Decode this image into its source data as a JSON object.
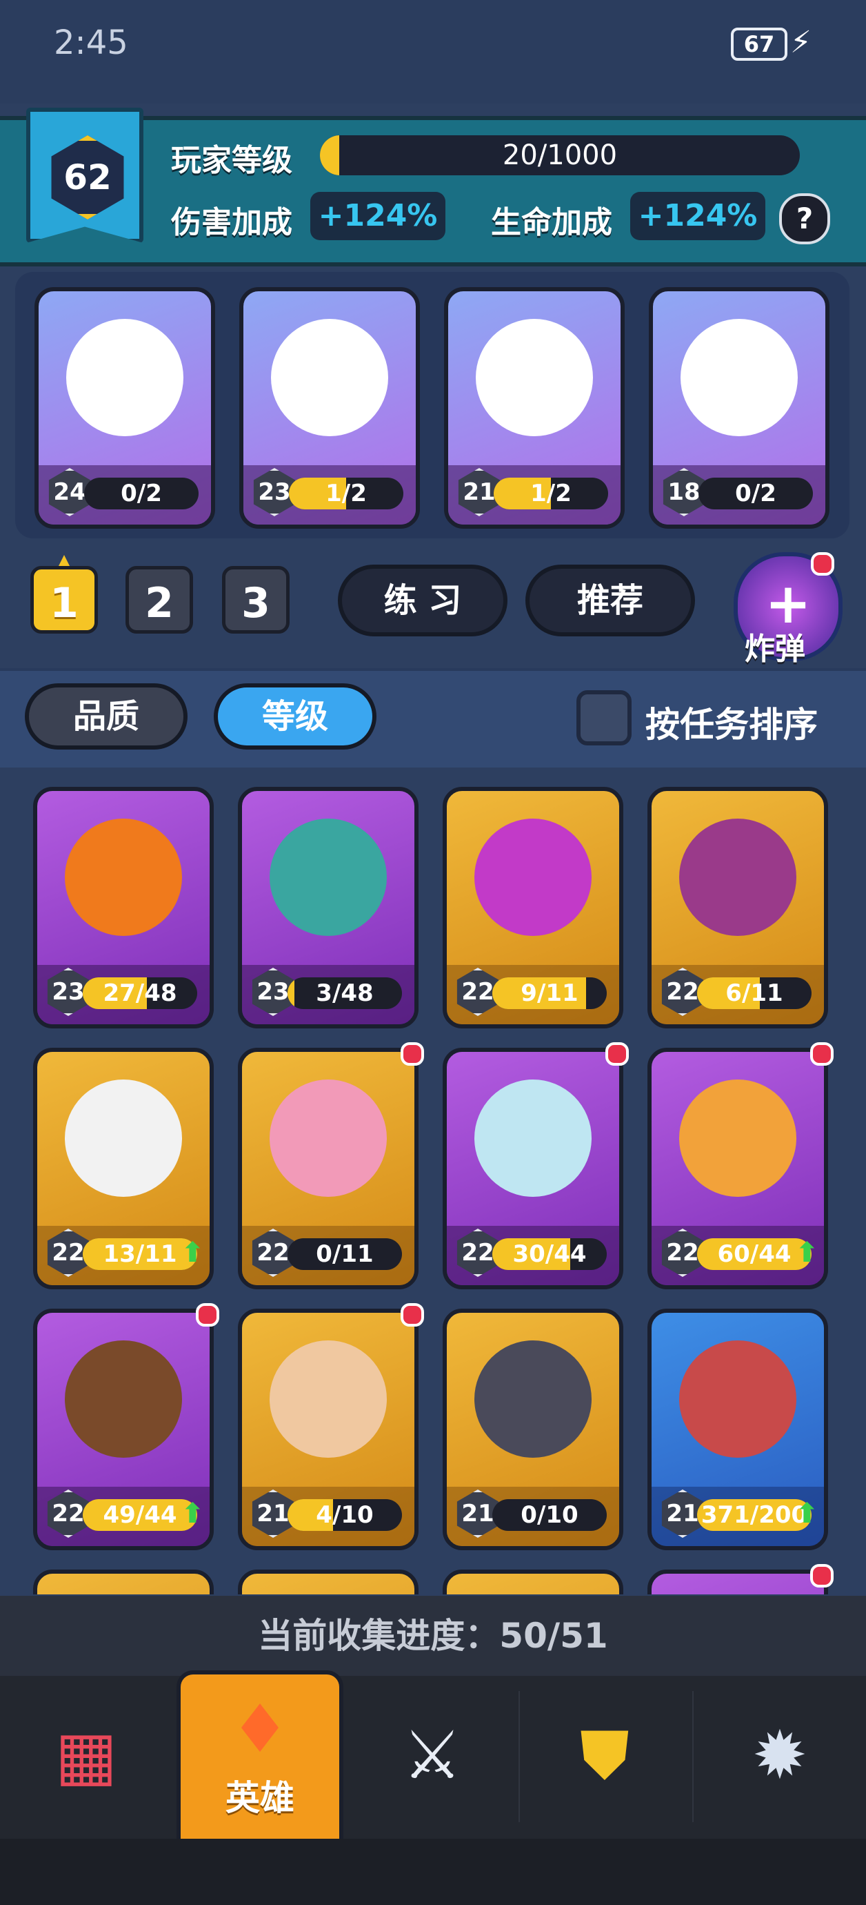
{
  "status_bar": {
    "time": "2:45",
    "battery": "67"
  },
  "player": {
    "level": "62",
    "xp_label": "玩家等级",
    "xp_text": "20/1000",
    "xp_progress": 0.02,
    "damage_label": "伤害加成",
    "damage_value": "+124%",
    "hp_label": "生命加成",
    "hp_value": "+124%",
    "help_icon": "?"
  },
  "team": [
    {
      "level": "24",
      "progress": "0/2",
      "fill": 0.0,
      "color": "team"
    },
    {
      "level": "23",
      "progress": "1/2",
      "fill": 0.5,
      "color": "team"
    },
    {
      "level": "21",
      "progress": "1/2",
      "fill": 0.5,
      "color": "team"
    },
    {
      "level": "18",
      "progress": "0/2",
      "fill": 0.0,
      "color": "team"
    }
  ],
  "controls": {
    "slots": [
      "1",
      "2",
      "3"
    ],
    "practice": "练 习",
    "recommend": "推荐",
    "bomb_label": "炸弹",
    "bomb_icon": "+"
  },
  "sort": {
    "quality": "品质",
    "level": "等级",
    "by_task": "按任务排序"
  },
  "heroes": [
    {
      "level": "23",
      "progress": "27/48",
      "fill": 0.56,
      "color": "purple",
      "dot": false,
      "up": false,
      "face": "#f07a1c"
    },
    {
      "level": "23",
      "progress": "3/48",
      "fill": 0.06,
      "color": "purple",
      "dot": false,
      "up": false,
      "face": "#3aa6a0"
    },
    {
      "level": "22",
      "progress": "9/11",
      "fill": 0.82,
      "color": "gold",
      "dot": false,
      "up": false,
      "face": "#c23ac8"
    },
    {
      "level": "22",
      "progress": "6/11",
      "fill": 0.55,
      "color": "gold",
      "dot": false,
      "up": false,
      "face": "#9a3a8a"
    },
    {
      "level": "22",
      "progress": "13/11",
      "fill": 1.0,
      "color": "gold",
      "dot": false,
      "up": true,
      "face": "#f2f2f2"
    },
    {
      "level": "22",
      "progress": "0/11",
      "fill": 0.0,
      "color": "gold",
      "dot": true,
      "up": false,
      "face": "#f29ab8"
    },
    {
      "level": "22",
      "progress": "30/44",
      "fill": 0.68,
      "color": "purple",
      "dot": true,
      "up": false,
      "face": "#bfe6f2"
    },
    {
      "level": "22",
      "progress": "60/44",
      "fill": 1.0,
      "color": "purple",
      "dot": true,
      "up": true,
      "face": "#f2a23a"
    },
    {
      "level": "22",
      "progress": "49/44",
      "fill": 1.0,
      "color": "purple",
      "dot": true,
      "up": true,
      "face": "#7a4a2a"
    },
    {
      "level": "21",
      "progress": "4/10",
      "fill": 0.4,
      "color": "gold",
      "dot": true,
      "up": false,
      "face": "#f0c8a0"
    },
    {
      "level": "21",
      "progress": "0/10",
      "fill": 0.0,
      "color": "gold",
      "dot": false,
      "up": false,
      "face": "#4a4a5a"
    },
    {
      "level": "21",
      "progress": "371/200",
      "fill": 1.0,
      "color": "blue",
      "dot": false,
      "up": true,
      "face": "#c84a4a"
    },
    {
      "level": "",
      "progress": "",
      "fill": 0.0,
      "color": "gold",
      "dot": false,
      "up": false,
      "face": "#6ab8f0"
    },
    {
      "level": "",
      "progress": "",
      "fill": 0.0,
      "color": "gold",
      "dot": false,
      "up": false,
      "face": "#e0a040"
    },
    {
      "level": "",
      "progress": "",
      "fill": 0.0,
      "color": "gold",
      "dot": false,
      "up": false,
      "face": "#404040"
    },
    {
      "level": "",
      "progress": "",
      "fill": 0.0,
      "color": "purple",
      "dot": true,
      "up": false,
      "face": "#9a4ad0"
    }
  ],
  "collection": {
    "text": "当前收集进度：50/51"
  },
  "nav": {
    "items": [
      {
        "name": "shop",
        "icon": "shop-icon"
      },
      {
        "name": "heroes",
        "icon": "hero-cards-icon",
        "label": "英雄"
      },
      {
        "name": "battle",
        "icon": "crossed-swords-icon"
      },
      {
        "name": "clan",
        "icon": "shield-crest-icon"
      },
      {
        "name": "events",
        "icon": "rocket-icon"
      }
    ]
  },
  "colors": {
    "accent": "#f5c425",
    "selected_blue": "#3aa6f0",
    "nav_active": "#f39a1b"
  }
}
